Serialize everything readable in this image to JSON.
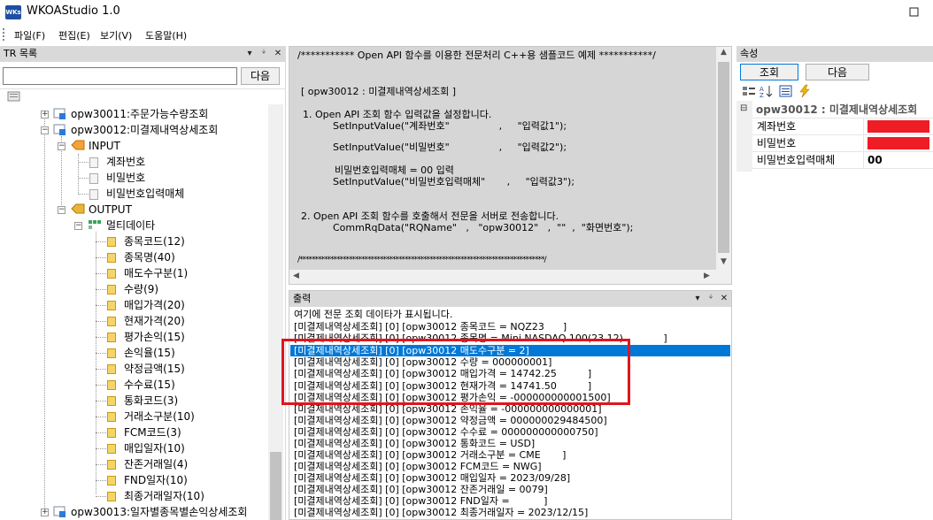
{
  "window": {
    "title": "WKOAStudio 1.0",
    "icon_text": "WKs",
    "icon_name": "app-logo-icon"
  },
  "menu": [
    {
      "label": "파일(F)"
    },
    {
      "label": "편집(E)"
    },
    {
      "label": "보기(V)"
    },
    {
      "label": "도움말(H)"
    }
  ],
  "tr_panel": {
    "title": "TR 목록",
    "search_value": "",
    "next_button": "다음",
    "tree": {
      "opw30011": "opw30011:주문가능수량조회",
      "opw30012": "opw30012:미결제내역상세조회",
      "input": "INPUT",
      "inputs": [
        "계좌번호",
        "비밀번호",
        "비밀번호입력매체"
      ],
      "output": "OUTPUT",
      "multi": "멀티데이타",
      "outputs": [
        "종목코드(12)",
        "종목명(40)",
        "매도수구분(1)",
        "수량(9)",
        "매입가격(20)",
        "현재가격(20)",
        "평가손익(15)",
        "손익율(15)",
        "약정금액(15)",
        "수수료(15)",
        "통화코드(3)",
        "거래소구분(10)",
        "FCM코드(3)",
        "매입일자(10)",
        "잔존거래일(4)",
        "FND일자(10)",
        "최종거래일자(10)"
      ],
      "opw30013": "opw30013:일자별종목별손익상세조회"
    }
  },
  "source": {
    "lines": [
      "/*********** Open API 함수를 이용한 전문처리 C++용 샘플코드 예제 ***********/",
      "[ opw30012 : 미결제내역상세조회 ]",
      "1. Open API 조회 함수 입력값을 설정합니다.",
      "SetInputValue(\"계좌번호\"                ,     \"입력값1\");",
      "SetInputValue(\"비밀번호\"                ,     \"입력값2\");",
      "비밀번호입력매체 = 00 입력",
      "SetInputValue(\"비밀번호입력매체\"       ,     \"입력값3\");",
      "2. Open API 조회 함수를 호출해서 전문을 서버로 전송합니다.",
      "CommRqData(\"RQName\"   ,   \"opw30012\"   ,  \"\"  ,  \"화면번호\");",
      "/*******************************************************************************/"
    ]
  },
  "output_panel": {
    "title": "출력",
    "lines": [
      "여기에 전문 조회 데이타가 표시됩니다.",
      "[미결제내역상세조회] [0] [opw30012 종목코드 = NQZ23      ]",
      "[미결제내역상세조회] [0] [opw30012 종목명 = Mini NASDAQ 100(23.12)             ]",
      "[미결제내역상세조회] [0] [opw30012 매도수구분 = 2]",
      "[미결제내역상세조회] [0] [opw30012 수량 = 000000001]",
      "[미결제내역상세조회] [0] [opw30012 매입가격 = 14742.25          ]",
      "[미결제내역상세조회] [0] [opw30012 현재가격 = 14741.50          ]",
      "[미결제내역상세조회] [0] [opw30012 평가손익 = -000000000001500]",
      "[미결제내역상세조회] [0] [opw30012 손익율 = -000000000000001]",
      "[미결제내역상세조회] [0] [opw30012 약정금액 = 000000029484500]",
      "[미결제내역상세조회] [0] [opw30012 수수료 = 000000000000750]",
      "[미결제내역상세조회] [0] [opw30012 통화코드 = USD]",
      "[미결제내역상세조회] [0] [opw30012 거래소구분 = CME       ]",
      "[미결제내역상세조회] [0] [opw30012 FCM코드 = NWG]",
      "[미결제내역상세조회] [0] [opw30012 매입일자 = 2023/09/28]",
      "[미결제내역상세조회] [0] [opw30012 잔존거래일 = 0079]",
      "[미결제내역상세조회] [0] [opw30012 FND일자 =           ]",
      "[미결제내역상세조회] [0] [opw30012 최종거래일자 = 2023/12/15]"
    ]
  },
  "props": {
    "title": "속성",
    "query_button": "조회",
    "next_button": "다음",
    "group": "opw30012 : 미결제내역상세조회",
    "rows": [
      {
        "name": "계좌번호",
        "value": ""
      },
      {
        "name": "비밀번호",
        "value": ""
      },
      {
        "name": "비밀번호입력매체",
        "value": "00"
      }
    ]
  },
  "colors": {
    "highlight": "#0078d7",
    "annotation": "#e0141e",
    "redacted": "#ee1c25"
  }
}
